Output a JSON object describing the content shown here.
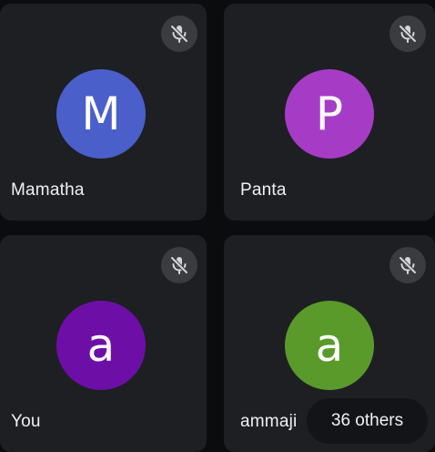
{
  "participants": [
    {
      "name": "Mamatha",
      "initial": "M",
      "avatar_color": "#4a5fc9",
      "muted": true,
      "mute_icon": "mic-off-icon"
    },
    {
      "name": "Panta",
      "initial": "P",
      "avatar_color": "#a63cc6",
      "muted": true,
      "mute_icon": "mic-off-icon"
    },
    {
      "name": "You",
      "initial": "a",
      "avatar_color": "#6d0fa6",
      "muted": true,
      "mute_icon": "mic-off-icon"
    },
    {
      "name": "ammaji",
      "initial": "a",
      "avatar_color": "#5a9a2a",
      "muted": true,
      "mute_icon": "mic-off-icon"
    }
  ],
  "others_label": "36 others",
  "colors": {
    "background": "#0b0c0e",
    "tile": "#1e1f23",
    "mute_badge": "#3b3c40",
    "text": "#f1f1f1"
  }
}
